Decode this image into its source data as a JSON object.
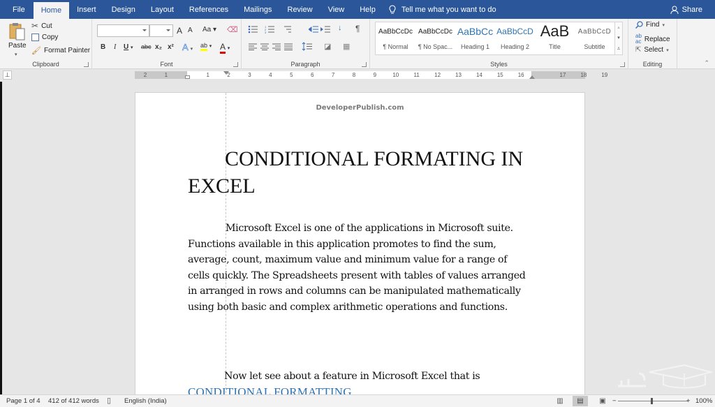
{
  "tabs": [
    {
      "label": "File",
      "active": false
    },
    {
      "label": "Home",
      "active": true
    },
    {
      "label": "Insert",
      "active": false
    },
    {
      "label": "Design",
      "active": false
    },
    {
      "label": "Layout",
      "active": false
    },
    {
      "label": "References",
      "active": false
    },
    {
      "label": "Mailings",
      "active": false
    },
    {
      "label": "Review",
      "active": false
    },
    {
      "label": "View",
      "active": false
    },
    {
      "label": "Help",
      "active": false
    }
  ],
  "tell_me": "Tell me what you want to do",
  "share_label": "Share",
  "ribbon": {
    "clipboard": {
      "label": "Clipboard",
      "paste": "Paste",
      "cut": "Cut",
      "copy": "Copy",
      "format_painter": "Format Painter"
    },
    "font": {
      "label": "Font",
      "font_name": "",
      "font_size": "",
      "grow": "A",
      "shrink": "A",
      "change_case": "Aa",
      "bold": "B",
      "italic": "I",
      "underline": "U",
      "strikethrough": "abc",
      "subscript": "x₂",
      "superscript": "x²",
      "text_effects": "A",
      "highlight": "ab",
      "font_color": "A",
      "highlight_color": "#ffff00",
      "font_color_value": "#e00000"
    },
    "paragraph": {
      "label": "Paragraph",
      "show_marks": "¶"
    },
    "styles": {
      "label": "Styles",
      "items": [
        {
          "preview": "AaBbCcDc",
          "name": "¶ Normal"
        },
        {
          "preview": "AaBbCcDc",
          "name": "¶ No Spac..."
        },
        {
          "preview": "AaBbCc",
          "name": "Heading 1"
        },
        {
          "preview": "AaBbCcD",
          "name": "Heading 2"
        },
        {
          "preview": "AaB",
          "name": "Title"
        },
        {
          "preview": "AaBbCcD",
          "name": "Subtitle"
        }
      ]
    },
    "editing": {
      "label": "Editing",
      "find": "Find",
      "replace": "Replace",
      "select": "Select"
    }
  },
  "ruler": {
    "numbers": [
      "2",
      "1",
      "",
      "1",
      "2",
      "3",
      "4",
      "5",
      "6",
      "7",
      "8",
      "9",
      "10",
      "11",
      "12",
      "13",
      "14",
      "15",
      "16",
      "",
      "17",
      "18",
      "19"
    ]
  },
  "document": {
    "header": "DeveloperPublish.com",
    "title": "CONDITIONAL FORMATING IN EXCEL",
    "paragraph1": "Microsoft Excel is one of the applications in Microsoft suite. Functions available in this application promotes to find the sum, average, count, maximum value and minimum value for a range of cells quickly. The Spreadsheets present with tables of values arranged in arranged in rows and columns can be manipulated mathematically using both basic and complex arithmetic operations and functions.",
    "paragraph2": "Now let see about a feature in Microsoft Excel that is",
    "link_text": "CONDITIONAL FORMATTING"
  },
  "status": {
    "page": "Page 1 of 4",
    "words": "412 of 412 words",
    "language": "English (India)",
    "zoom": "100%",
    "zoom_minus": "−",
    "zoom_plus": "+"
  },
  "colors": {
    "accent": "#2b579a",
    "link": "#2e74b5"
  }
}
